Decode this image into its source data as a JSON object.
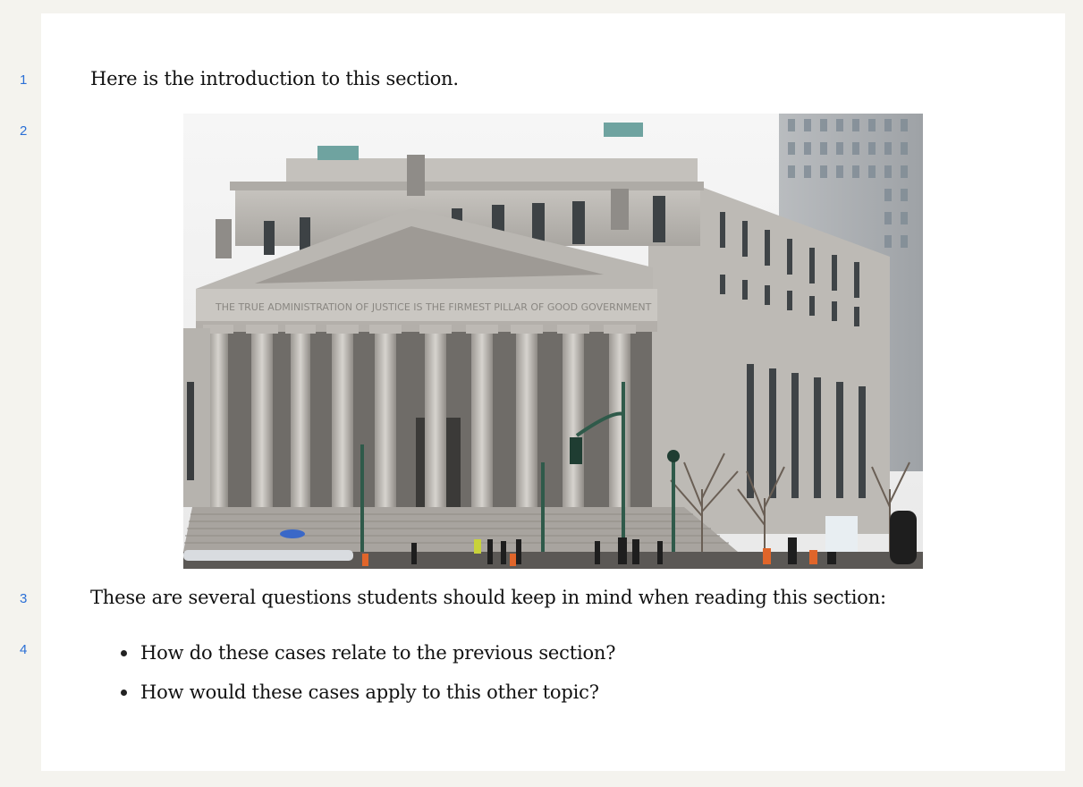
{
  "lines": {
    "n1": "1",
    "n2": "2",
    "n3": "3",
    "n4": "4"
  },
  "intro": "Here is the introduction to this section.",
  "figure": {
    "subject": "courthouse-photo",
    "frieze_text": "THE TRUE ADMINISTRATION OF JUSTICE IS THE FIRMEST PILLAR OF GOOD GOVERNMENT"
  },
  "questions_lead": "These are several questions students should keep in mind when reading this section:",
  "questions": [
    "How do these cases relate to the previous section?",
    "How would these cases apply to this other topic?"
  ]
}
